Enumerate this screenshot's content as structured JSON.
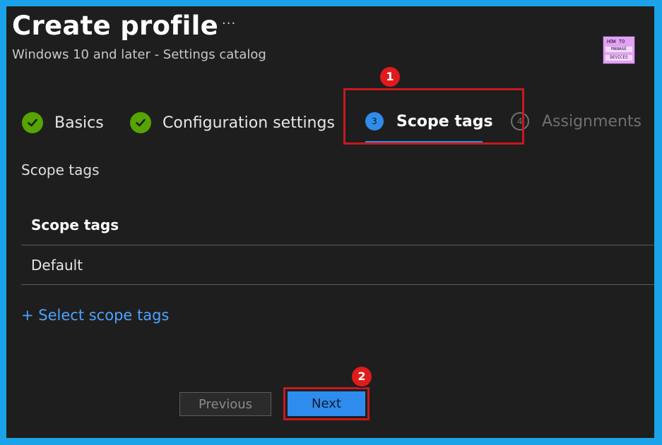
{
  "header": {
    "title": "Create profile",
    "more": "···",
    "subtitle": "Windows 10 and later - Settings catalog",
    "logo": {
      "line1": "HOW TO",
      "line2": "MANAGE",
      "line3": "DEVICES"
    }
  },
  "steps": [
    {
      "label": "Basics",
      "state": "completed",
      "icon": "check-icon"
    },
    {
      "label": "Configuration settings",
      "state": "completed",
      "icon": "check-icon"
    },
    {
      "label": "Scope tags",
      "state": "active",
      "number": "3"
    },
    {
      "label": "Assignments",
      "state": "disabled",
      "number": "4"
    }
  ],
  "annotations": {
    "badge1": "1",
    "badge2": "2"
  },
  "main": {
    "section_label": "Scope tags",
    "table": {
      "header": "Scope tags",
      "rows": [
        "Default"
      ]
    },
    "add_link": "+ Select scope tags"
  },
  "footer": {
    "previous_label": "Previous",
    "next_label": "Next"
  },
  "colors": {
    "page_border": "#1aa3e8",
    "background": "#1e1e1e",
    "accent": "#2d8cee",
    "complete": "#57a300",
    "annotation_red": "#e01b1b",
    "link": "#4aa3ff"
  }
}
